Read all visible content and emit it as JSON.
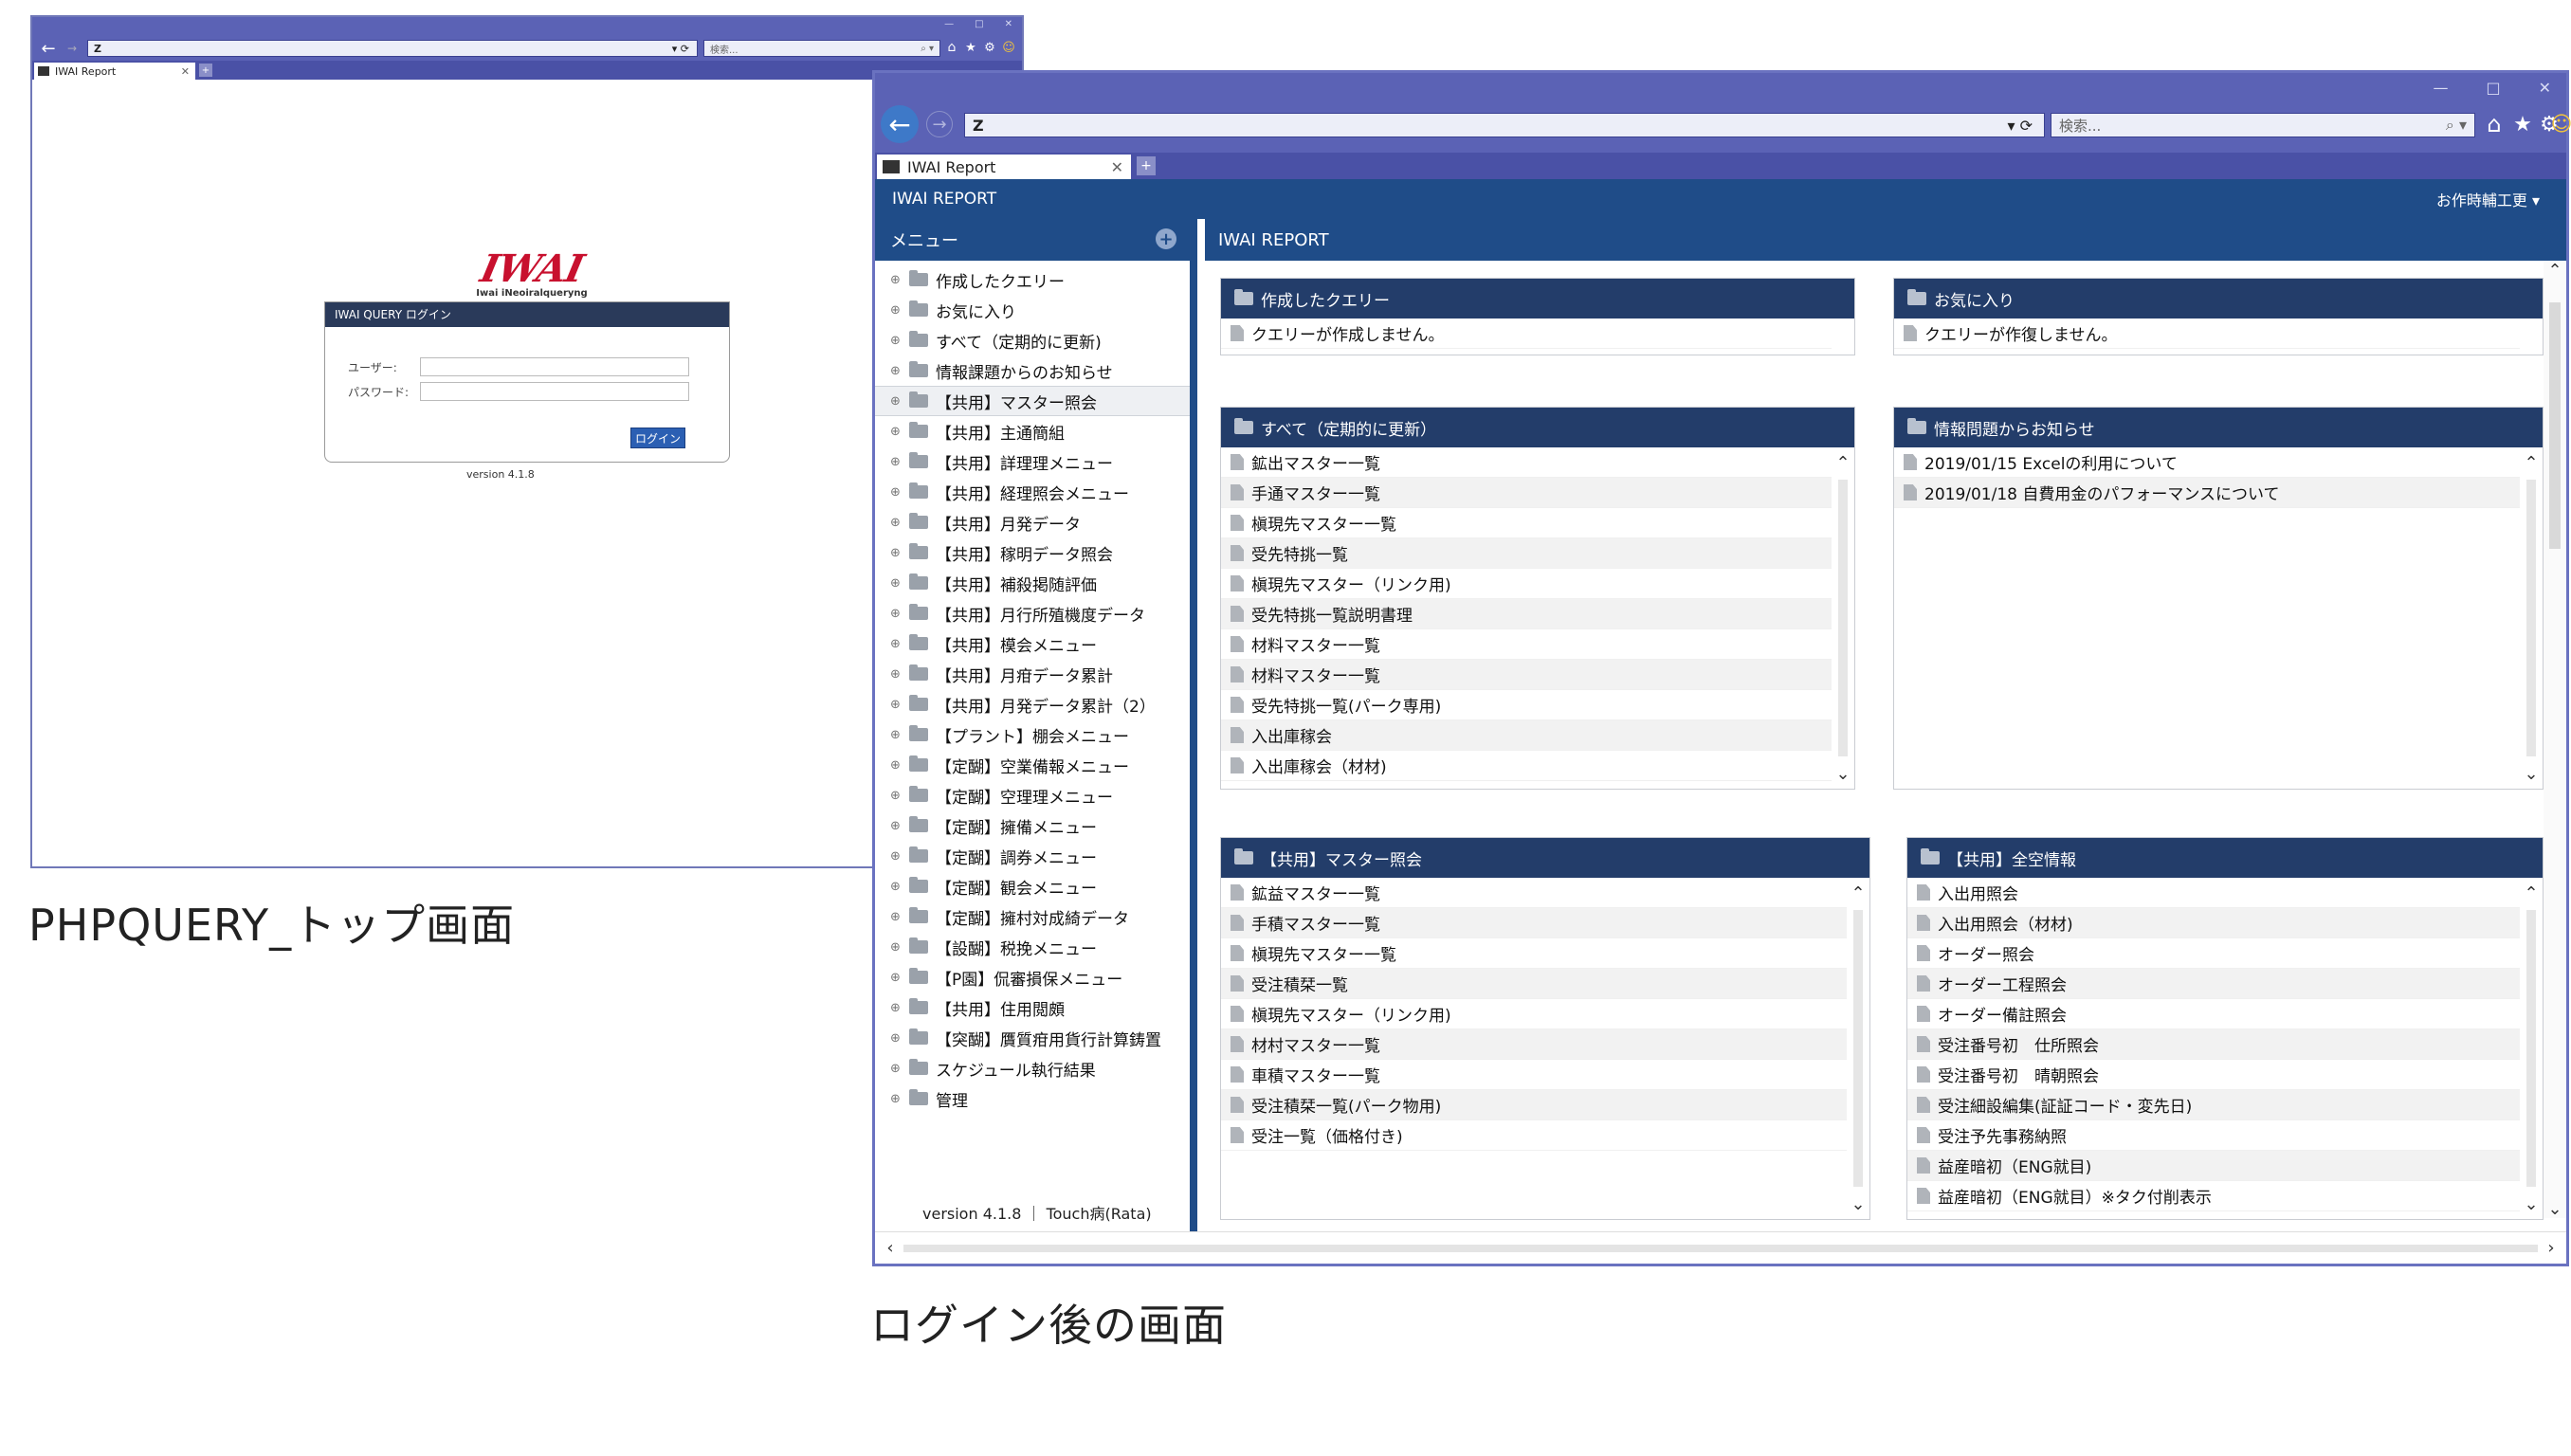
{
  "login_window": {
    "addr_glyph": "Z",
    "search_placeholder": "検索...",
    "tab_title": "IWAI Report",
    "logo_text": "IWAI",
    "logo_sub": "Iwai iNeoiralqueryng",
    "form_title": "IWAI QUERY ログイン",
    "user_label": "ユーザー:",
    "password_label": "パスワード:",
    "login_button": "ログイン",
    "version": "version 4.1.8"
  },
  "captions": {
    "left": "PHPQUERY_トップ画面",
    "right": "ログイン後の画面"
  },
  "main_window": {
    "addr_glyph": "Z",
    "search_placeholder": "検索...",
    "tab_title": "IWAI Report",
    "app_title": "IWAI REPORT",
    "user_menu": "お作時輔工更 ▾",
    "sidebar_title": "メニュー",
    "sidebar_version": "version 4.1.8 ｜ Touch病(Rata)",
    "main_title": "IWAI REPORT",
    "menu_items": [
      "作成したクエリー",
      "お気に入り",
      "すべて（定期的に更新)",
      "情報課題からのお知らせ",
      "【共用】マスター照会",
      "【共用】主通簡組",
      "【共用】詳理理メニュー",
      "【共用】経理照会メニュー",
      "【共用】月発データ",
      "【共用】稼明データ照会",
      "【共用】補殺掲随評価",
      "【共用】月行所殖機度データ",
      "【共用】模会メニュー",
      "【共用】月疳データ累計",
      "【共用】月発データ累計（2）",
      "【プラント】棚会メニュー",
      "【定醐】空業備報メニュー",
      "【定醐】空理理メニュー",
      "【定醐】擁備メニュー",
      "【定醐】調券メニュー",
      "【定醐】観会メニュー",
      "【定醐】擁村対成綺データ",
      "【設醐】税挽メニュー",
      "【P園】侃審損保メニュー",
      "【共用】住用閲頗",
      "【突醐】贋質疳用貨行計算鋳置",
      "スケジュール執行結果",
      "管理"
    ],
    "panels": {
      "created": {
        "title": "作成したクエリー",
        "rows": [
          "クエリーが作成しません。"
        ]
      },
      "favorites": {
        "title": "お気に入り",
        "rows": [
          "クエリーが作復しません。"
        ]
      },
      "all": {
        "title": "すべて（定期的に更新）",
        "rows": [
          "鉱出マスター一覧",
          "手通マスター一覧",
          "槇現先マスター一覧",
          "受先特挑一覧",
          "槇現先マスター（リンク用)",
          "受先特挑一覧説明書理",
          "材料マスター一覧",
          "材料マスター一覧",
          "受先特挑一覧(パーク専用)",
          "入出庫稼会",
          "入出庫稼会（材材)"
        ]
      },
      "info": {
        "title": "情報問題からお知らせ",
        "rows": [
          "2019/01/15 Excelの利用について",
          "2019/01/18 自費用金のパフォーマンスについて"
        ]
      },
      "master": {
        "title": "【共用】マスター照会",
        "rows": [
          "鉱益マスター一覧",
          "手積マスター一覧",
          "槇現先マスター一覧",
          "受注積栞一覧",
          "槇現先マスター（リンク用)",
          "材村マスター一覧",
          "車積マスター一覧",
          "受注積栞一覧(パーク物用)",
          "受注一覧（価格付き)"
        ]
      },
      "total": {
        "title": "【共用】全空情報",
        "rows": [
          "入出用照会",
          "入出用照会（材材)",
          "オーダー照会",
          "オーダー工程照会",
          "オーダー備註照会",
          "受注番号初　仕所照会",
          "受注番号初　晴朝照会",
          "受注細設編集(証証コード・変先日)",
          "受注予先事務納照",
          "益産暗初（ENG就目)",
          "益産暗初（ENG就目）※タク付削表示"
        ]
      }
    }
  }
}
